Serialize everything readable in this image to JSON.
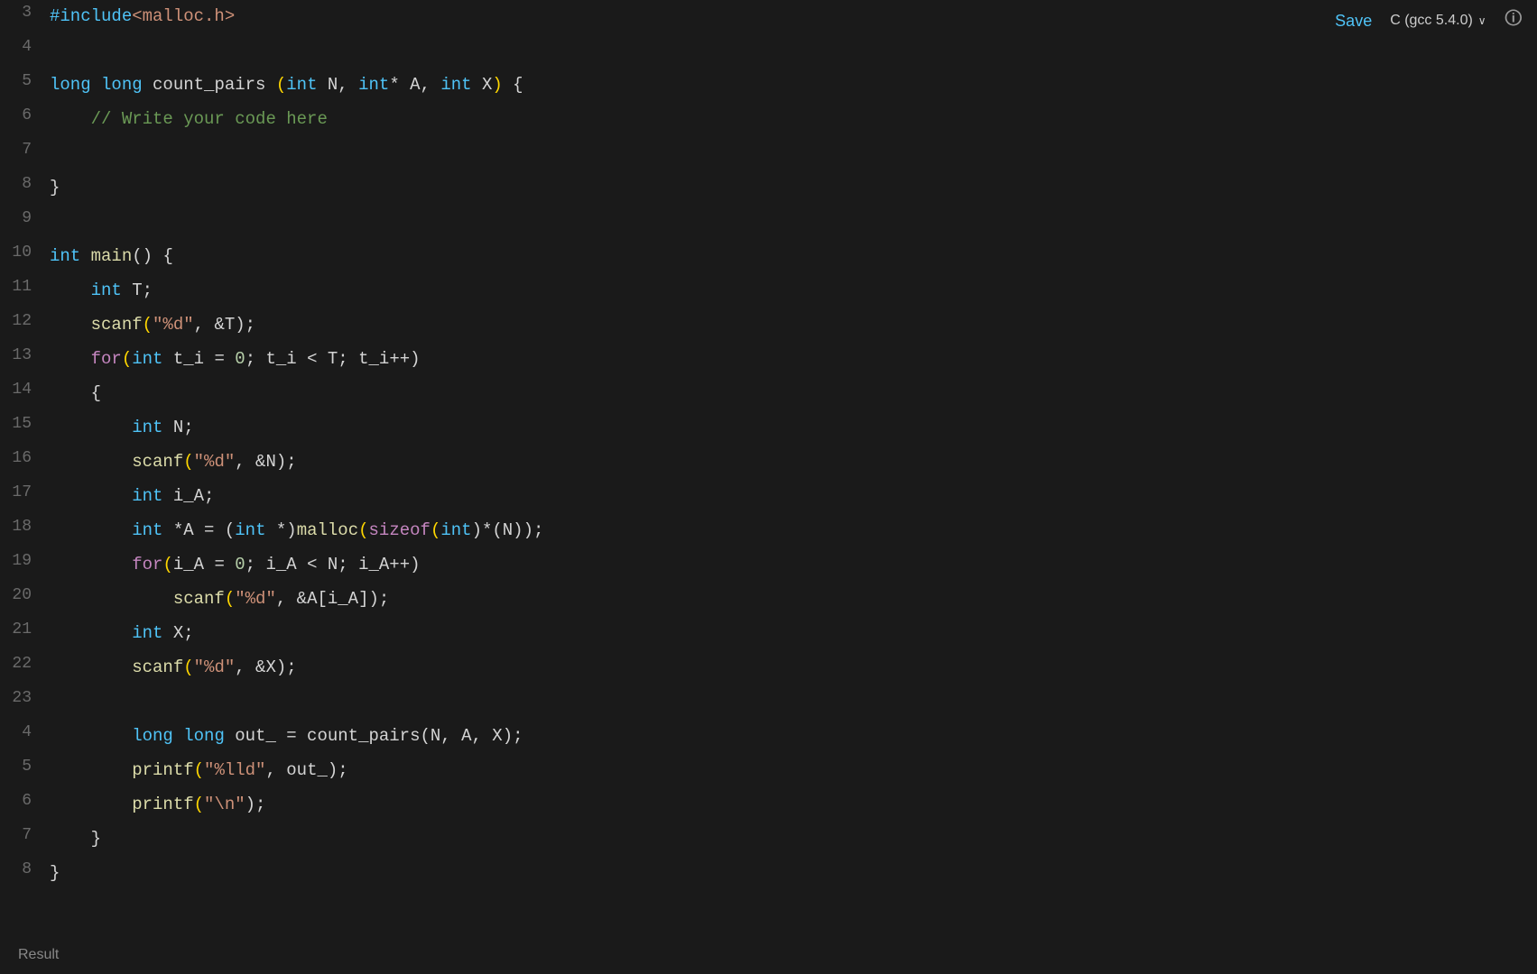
{
  "header": {
    "save_label": "Save",
    "language_label": "C (gcc 5.4.0)",
    "chevron": "∨"
  },
  "editor": {
    "lines": [
      {
        "num": "3",
        "tokens": [
          {
            "t": "#include",
            "c": "macro"
          },
          {
            "t": "<malloc.h>",
            "c": "include-name"
          }
        ]
      },
      {
        "num": "4",
        "tokens": []
      },
      {
        "num": "5",
        "tokens": [
          {
            "t": "long",
            "c": "kw-type"
          },
          {
            "t": " ",
            "c": "plain"
          },
          {
            "t": "long",
            "c": "kw-type"
          },
          {
            "t": " count_pairs ",
            "c": "plain"
          },
          {
            "t": "(",
            "c": "paren"
          },
          {
            "t": "int",
            "c": "kw-type"
          },
          {
            "t": " N, ",
            "c": "plain"
          },
          {
            "t": "int",
            "c": "kw-type"
          },
          {
            "t": "* A, ",
            "c": "plain"
          },
          {
            "t": "int",
            "c": "kw-type"
          },
          {
            "t": " X",
            "c": "plain"
          },
          {
            "t": ")",
            "c": "paren"
          },
          {
            "t": " {",
            "c": "plain"
          }
        ]
      },
      {
        "num": "6",
        "tokens": [
          {
            "t": "    ",
            "c": "plain"
          },
          {
            "t": "// Write your code here",
            "c": "comment"
          }
        ]
      },
      {
        "num": "7",
        "tokens": []
      },
      {
        "num": "8",
        "tokens": [
          {
            "t": "}",
            "c": "plain"
          }
        ]
      },
      {
        "num": "9",
        "tokens": []
      },
      {
        "num": "10",
        "tokens": [
          {
            "t": "int",
            "c": "kw-type"
          },
          {
            "t": " ",
            "c": "plain"
          },
          {
            "t": "main",
            "c": "fn-name"
          },
          {
            "t": "() {",
            "c": "plain"
          }
        ]
      },
      {
        "num": "11",
        "tokens": [
          {
            "t": "    ",
            "c": "plain"
          },
          {
            "t": "int",
            "c": "kw-type"
          },
          {
            "t": " T;",
            "c": "plain"
          }
        ]
      },
      {
        "num": "12",
        "tokens": [
          {
            "t": "    ",
            "c": "plain"
          },
          {
            "t": "scanf",
            "c": "fn-name"
          },
          {
            "t": "(",
            "c": "paren"
          },
          {
            "t": "\"%d\"",
            "c": "string"
          },
          {
            "t": ", &T);",
            "c": "plain"
          }
        ]
      },
      {
        "num": "13",
        "tokens": [
          {
            "t": "    ",
            "c": "plain"
          },
          {
            "t": "for",
            "c": "kw-flow"
          },
          {
            "t": "(",
            "c": "paren"
          },
          {
            "t": "int",
            "c": "kw-type"
          },
          {
            "t": " t_i = ",
            "c": "plain"
          },
          {
            "t": "0",
            "c": "number"
          },
          {
            "t": "; t_i < T; t_i++)",
            "c": "plain"
          }
        ]
      },
      {
        "num": "14",
        "tokens": [
          {
            "t": "    {",
            "c": "plain"
          }
        ]
      },
      {
        "num": "15",
        "tokens": [
          {
            "t": "        ",
            "c": "plain"
          },
          {
            "t": "int",
            "c": "kw-type"
          },
          {
            "t": " N;",
            "c": "plain"
          }
        ]
      },
      {
        "num": "16",
        "tokens": [
          {
            "t": "        ",
            "c": "plain"
          },
          {
            "t": "scanf",
            "c": "fn-name"
          },
          {
            "t": "(",
            "c": "paren"
          },
          {
            "t": "\"%d\"",
            "c": "string"
          },
          {
            "t": ", &N);",
            "c": "plain"
          }
        ]
      },
      {
        "num": "17",
        "tokens": [
          {
            "t": "        ",
            "c": "plain"
          },
          {
            "t": "int",
            "c": "kw-type"
          },
          {
            "t": " i_A;",
            "c": "plain"
          }
        ]
      },
      {
        "num": "18",
        "tokens": [
          {
            "t": "        ",
            "c": "plain"
          },
          {
            "t": "int",
            "c": "kw-type"
          },
          {
            "t": " *A = (",
            "c": "plain"
          },
          {
            "t": "int",
            "c": "kw-type"
          },
          {
            "t": " *)",
            "c": "plain"
          },
          {
            "t": "malloc",
            "c": "fn-name"
          },
          {
            "t": "(",
            "c": "paren"
          },
          {
            "t": "sizeof",
            "c": "kw-flow"
          },
          {
            "t": "(",
            "c": "paren"
          },
          {
            "t": "int",
            "c": "kw-type"
          },
          {
            "t": ")*(N));",
            "c": "plain"
          }
        ]
      },
      {
        "num": "19",
        "tokens": [
          {
            "t": "        ",
            "c": "plain"
          },
          {
            "t": "for",
            "c": "kw-flow"
          },
          {
            "t": "(",
            "c": "paren"
          },
          {
            "t": "i_A = ",
            "c": "plain"
          },
          {
            "t": "0",
            "c": "number"
          },
          {
            "t": "; i_A < N; i_A++)",
            "c": "plain"
          }
        ]
      },
      {
        "num": "20",
        "tokens": [
          {
            "t": "            ",
            "c": "plain"
          },
          {
            "t": "scanf",
            "c": "fn-name"
          },
          {
            "t": "(",
            "c": "paren"
          },
          {
            "t": "\"%d\"",
            "c": "string"
          },
          {
            "t": ", &A[i_A]);",
            "c": "plain"
          }
        ]
      },
      {
        "num": "21",
        "tokens": [
          {
            "t": "        ",
            "c": "plain"
          },
          {
            "t": "int",
            "c": "kw-type"
          },
          {
            "t": " X;",
            "c": "plain"
          }
        ]
      },
      {
        "num": "22",
        "tokens": [
          {
            "t": "        ",
            "c": "plain"
          },
          {
            "t": "scanf",
            "c": "fn-name"
          },
          {
            "t": "(",
            "c": "paren"
          },
          {
            "t": "\"%d\"",
            "c": "string"
          },
          {
            "t": ", &X);",
            "c": "plain"
          }
        ]
      },
      {
        "num": "23",
        "tokens": []
      },
      {
        "num": "4",
        "tokens": [
          {
            "t": "        ",
            "c": "plain"
          },
          {
            "t": "long",
            "c": "kw-type"
          },
          {
            "t": " ",
            "c": "plain"
          },
          {
            "t": "long",
            "c": "kw-type"
          },
          {
            "t": " out_ = count_pairs(N, A, X);",
            "c": "plain"
          }
        ]
      },
      {
        "num": "5",
        "tokens": [
          {
            "t": "        ",
            "c": "plain"
          },
          {
            "t": "printf",
            "c": "fn-name"
          },
          {
            "t": "(",
            "c": "paren"
          },
          {
            "t": "\"%lld\"",
            "c": "string"
          },
          {
            "t": ", out_);",
            "c": "plain"
          }
        ]
      },
      {
        "num": "6",
        "tokens": [
          {
            "t": "        ",
            "c": "plain"
          },
          {
            "t": "printf",
            "c": "fn-name"
          },
          {
            "t": "(",
            "c": "paren"
          },
          {
            "t": "\"\\n\"",
            "c": "string"
          },
          {
            "t": ");",
            "c": "plain"
          }
        ]
      },
      {
        "num": "7",
        "tokens": [
          {
            "t": "    }",
            "c": "plain"
          }
        ]
      },
      {
        "num": "8",
        "tokens": [
          {
            "t": "}",
            "c": "plain"
          }
        ]
      }
    ]
  },
  "bottom": {
    "label": "Result"
  }
}
